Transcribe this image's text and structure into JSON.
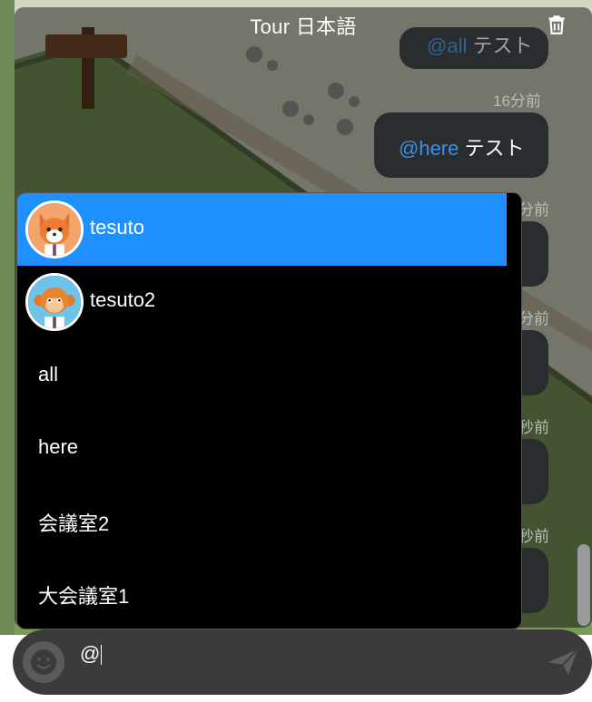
{
  "chat": {
    "title": "Tour 日本語",
    "messages": [
      {
        "mention": "@all",
        "text": " テスト"
      },
      {
        "time": "16分前",
        "mention": "@here",
        "text": " テスト"
      }
    ],
    "timestamps_partial": [
      "分前",
      "分前",
      "秒前",
      "秒前"
    ]
  },
  "mention_dropdown": {
    "items": [
      {
        "label": "tesuto",
        "avatar": "fox-avatar",
        "selected": true
      },
      {
        "label": "tesuto2",
        "avatar": "monkey-avatar",
        "selected": false
      },
      {
        "label": "all"
      },
      {
        "label": "here"
      },
      {
        "label": "会議室2"
      },
      {
        "label": "大会議室1"
      }
    ]
  },
  "input": {
    "value": "@"
  },
  "colors": {
    "accent": "#1e90ff",
    "mention": "#3d8fe0",
    "panel": "#000000",
    "bubble": "#2a2d30"
  },
  "icons": [
    "trash-icon",
    "emoji-icon",
    "send-icon"
  ]
}
